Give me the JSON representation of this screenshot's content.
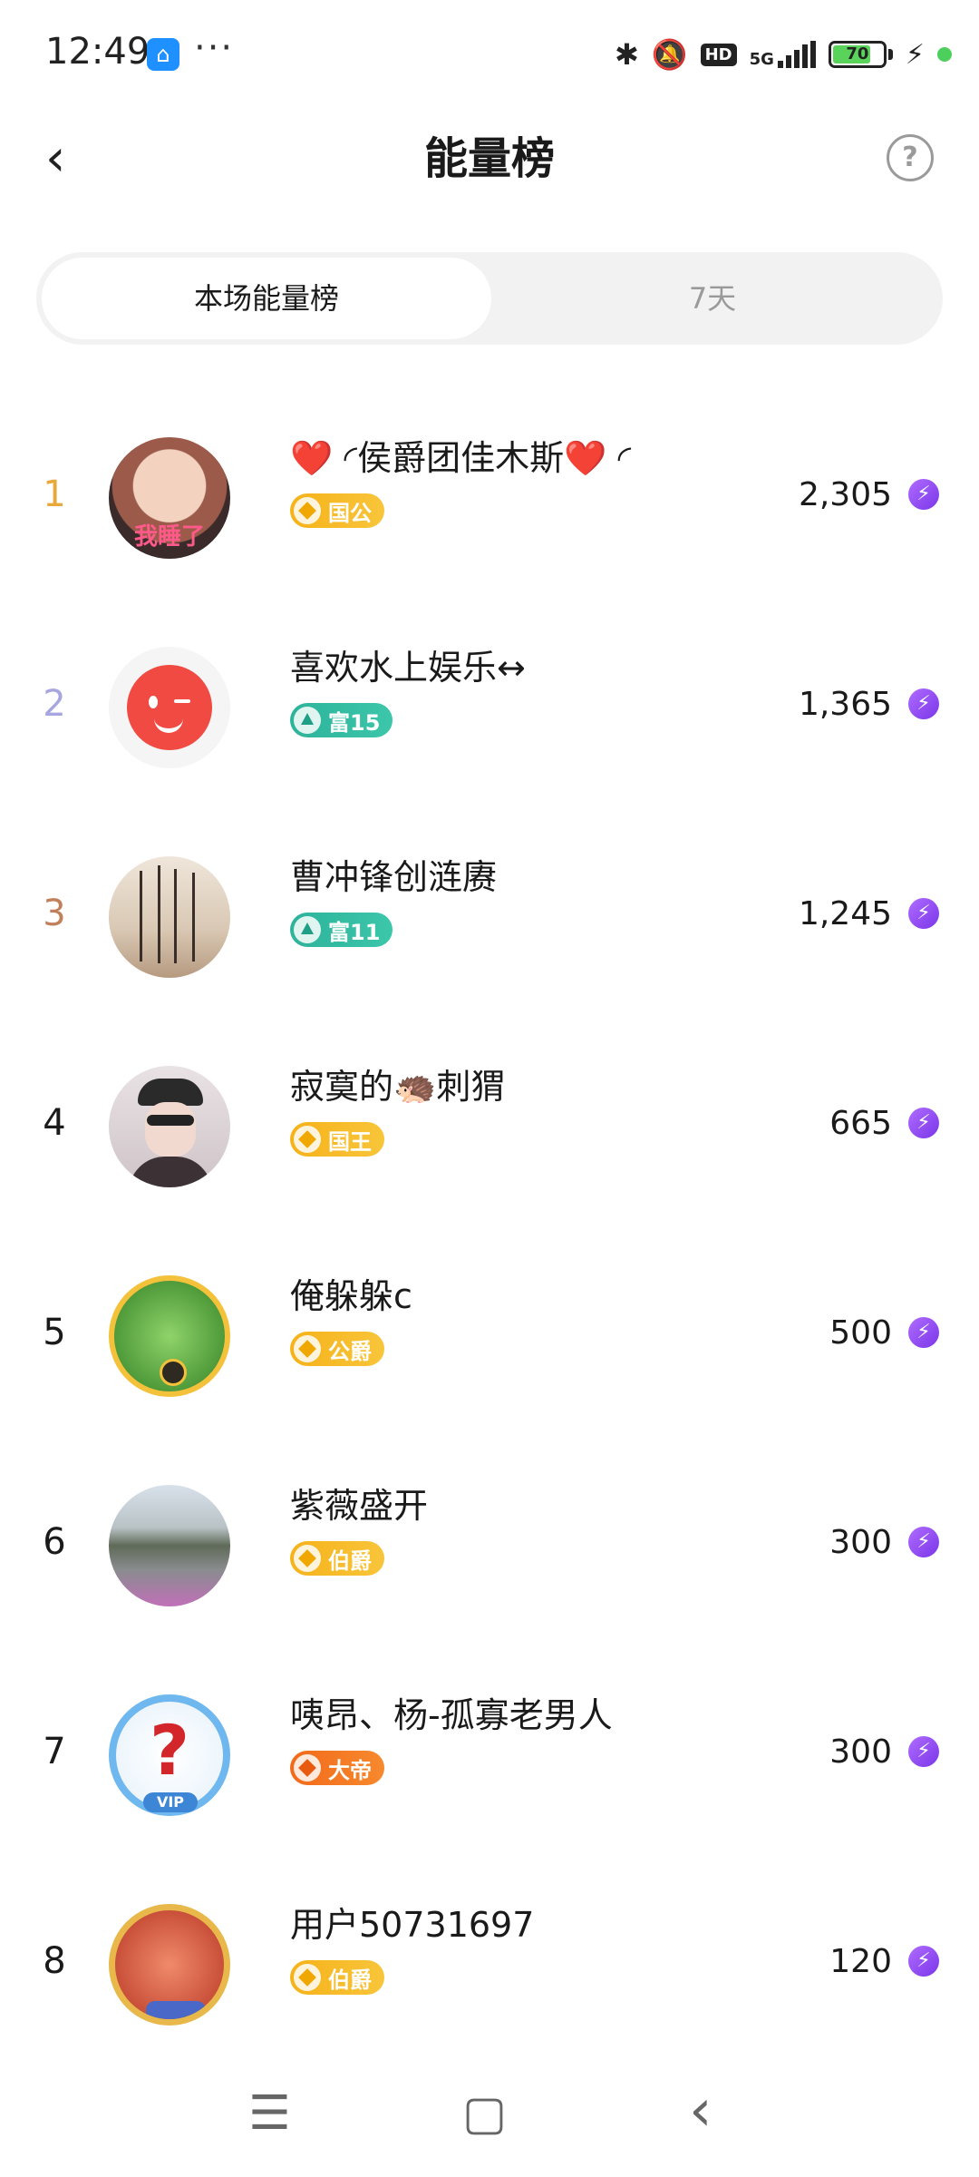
{
  "status_bar": {
    "time": "12:49",
    "more": "···",
    "icons": [
      "bluetooth-icon",
      "mute-icon",
      "hd-icon",
      "5g-signal-icon",
      "battery-icon",
      "charging-icon"
    ],
    "hd": "HD",
    "network": "5G",
    "battery": "70"
  },
  "header": {
    "back_icon": "‹",
    "title": "能量榜",
    "help_icon": "?"
  },
  "tabs": [
    {
      "label": "本场能量榜",
      "active": true
    },
    {
      "label": "7天",
      "active": false
    }
  ],
  "colors": {
    "rank1": "#e8a93a",
    "rank2": "#a8a6e0",
    "rank3": "#c2805a",
    "rank_default": "#222222",
    "energy_icon": "#8a44f0"
  },
  "ranking": [
    {
      "rank": "1",
      "name": "❤️ ◜侯爵团佳木斯❤️ ◜",
      "badge": "国公",
      "badge_style": "gold",
      "score": "2,305"
    },
    {
      "rank": "2",
      "name": "喜欢水上娱乐↔",
      "badge": "富15",
      "badge_style": "teal",
      "score": "1,365"
    },
    {
      "rank": "3",
      "name": "曹冲锋创涟赓",
      "badge": "富11",
      "badge_style": "teal",
      "score": "1,245"
    },
    {
      "rank": "4",
      "name": "寂寞的🦔刺猬",
      "badge": "国王",
      "badge_style": "gold",
      "score": "665"
    },
    {
      "rank": "5",
      "name": "俺躲躲c",
      "badge": "公爵",
      "badge_style": "gold",
      "score": "500"
    },
    {
      "rank": "6",
      "name": "紫薇盛开",
      "badge": "伯爵",
      "badge_style": "gold",
      "score": "300"
    },
    {
      "rank": "7",
      "name": "咦昂、杨-孤寡老男人",
      "badge": "大帝",
      "badge_style": "orange",
      "score": "300"
    },
    {
      "rank": "8",
      "name": "用户50731697",
      "badge": "伯爵",
      "badge_style": "gold",
      "score": "120"
    }
  ],
  "nav": {
    "menu_icon": "☰",
    "home_icon": "▢",
    "back_icon": "‹"
  }
}
